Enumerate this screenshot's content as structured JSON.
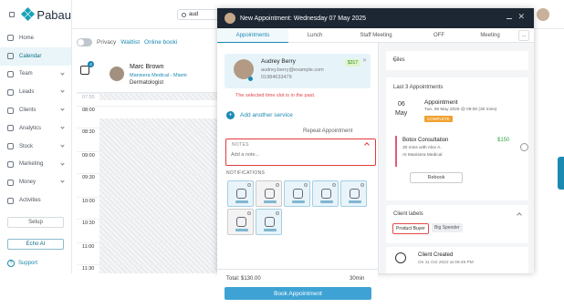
{
  "brand": {
    "name": "Pabau"
  },
  "sidebar": {
    "items": [
      {
        "label": "Home",
        "icon": "home-icon"
      },
      {
        "label": "Calendar",
        "icon": "calendar-icon",
        "active": true
      },
      {
        "label": "Team",
        "icon": "team-icon"
      },
      {
        "label": "Leads",
        "icon": "leads-icon"
      },
      {
        "label": "Clients",
        "icon": "clients-icon"
      },
      {
        "label": "Analytics",
        "icon": "analytics-icon"
      },
      {
        "label": "Stock",
        "icon": "stock-icon"
      },
      {
        "label": "Marketing",
        "icon": "marketing-icon"
      },
      {
        "label": "Money",
        "icon": "money-icon"
      },
      {
        "label": "Activities",
        "icon": "activities-icon"
      }
    ],
    "setup_label": "Setup",
    "echo_label": "Echo AI",
    "support_label": "Support"
  },
  "topbar": {
    "search_value": "aud"
  },
  "calendar": {
    "privacy_label": "Privacy",
    "waitlist_label": "Waitlist",
    "online_label": "Online booki",
    "filter_count": "4",
    "staff": {
      "name": "Marc Brown",
      "location": "Manisera Medical - Miami",
      "role": "Dermatologist"
    },
    "times": [
      "07:55",
      "08:00",
      "08:30",
      "09:00",
      "09:30",
      "10:00",
      "10:30",
      "11:00",
      "11:30"
    ]
  },
  "modal": {
    "title": "New Appointment: Wednesday 07 May 2025",
    "tabs": [
      "Appointments",
      "Lunch",
      "Staff Meeting",
      "OFF",
      "Meeting"
    ],
    "more_label": "...",
    "client": {
      "name": "Audrey Berry",
      "email": "audrey.berry@example.com",
      "phone": "01984633479",
      "balance": "$317"
    },
    "past_warning": "The selected time slot is in the past.",
    "add_service_label": "Add another service",
    "repeat_label": "Repeat Appointment",
    "notes": {
      "label": "NOTES",
      "placeholder": "Add a note..."
    },
    "notifications_label": "NOTIFICATIONS",
    "total_label": "Total: $130.00",
    "duration_label": "30min",
    "book_label": "Book Appointment"
  },
  "right_panel": {
    "files_label": "Files",
    "last_appointments_label": "Last 3 Appointments",
    "appointment": {
      "day": "06",
      "month": "May",
      "title": "Appointment",
      "details": "Tue, 06 May 2025 @ 09:00 (30 mins)",
      "status": "COMPLETE"
    },
    "service": {
      "name": "Botox Consultation",
      "price": "$150",
      "details": "30 mins with Alex A.",
      "location": "At Manisera Medical"
    },
    "rebook_label": "Rebook",
    "client_labels_title": "Client labels",
    "labels": [
      "Product Buyer",
      "Big Spender"
    ],
    "activity": {
      "title": "Client Created",
      "subtitle": "On 11 Oct 2022 at 09:49 PM"
    }
  },
  "colors": {
    "accent": "#1b8ab3",
    "header": "#1d2733",
    "highlight": "#e23a3a"
  }
}
